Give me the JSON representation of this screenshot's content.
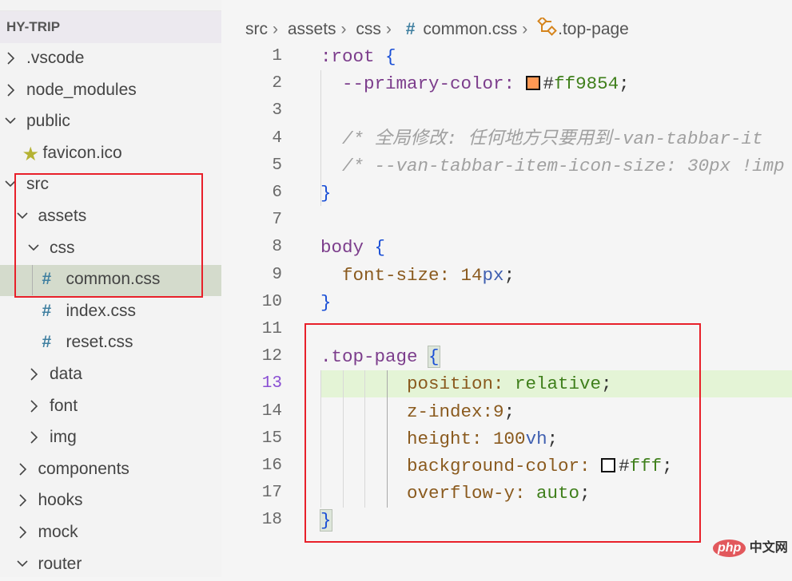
{
  "explorer": {
    "title": "HY-TRIP",
    "items": [
      {
        "label": ".vscode",
        "level": 0,
        "type": "folder",
        "expanded": false
      },
      {
        "label": "node_modules",
        "level": 0,
        "type": "folder",
        "expanded": false
      },
      {
        "label": "public",
        "level": 0,
        "type": "folder",
        "expanded": true
      },
      {
        "label": "favicon.ico",
        "level": 1,
        "type": "star-file"
      },
      {
        "label": "src",
        "level": 0,
        "type": "folder",
        "expanded": true
      },
      {
        "label": "assets",
        "level": 1,
        "type": "folder",
        "expanded": true
      },
      {
        "label": "css",
        "level": 2,
        "type": "folder",
        "expanded": true
      },
      {
        "label": "common.css",
        "level": 3,
        "type": "css-file",
        "selected": true
      },
      {
        "label": "index.css",
        "level": 3,
        "type": "css-file"
      },
      {
        "label": "reset.css",
        "level": 3,
        "type": "css-file"
      },
      {
        "label": "data",
        "level": 2,
        "type": "folder",
        "expanded": false
      },
      {
        "label": "font",
        "level": 2,
        "type": "folder",
        "expanded": false
      },
      {
        "label": "img",
        "level": 2,
        "type": "folder",
        "expanded": false
      },
      {
        "label": "components",
        "level": 1,
        "type": "folder",
        "expanded": false
      },
      {
        "label": "hooks",
        "level": 1,
        "type": "folder",
        "expanded": false
      },
      {
        "label": "mock",
        "level": 1,
        "type": "folder",
        "expanded": false
      },
      {
        "label": "router",
        "level": 1,
        "type": "folder",
        "expanded": true
      }
    ]
  },
  "breadcrumb": [
    "src",
    "assets",
    "css",
    "common.css",
    ".top-page"
  ],
  "editor": {
    "current_line": 13,
    "lines": [
      {
        "n": "1",
        "tokens": [
          [
            ":root ",
            "sel-prop"
          ],
          [
            "{",
            "brace"
          ]
        ]
      },
      {
        "n": "2",
        "tokens": [
          [
            "  --primary-color: ",
            "sel-prop"
          ],
          [
            "#swatch:#ff9854",
            ""
          ],
          [
            "#",
            "punc"
          ],
          [
            "ff9854",
            "hex"
          ],
          [
            ";",
            "punc"
          ]
        ]
      },
      {
        "n": "3",
        "tokens": []
      },
      {
        "n": "4",
        "tokens": [
          [
            "  /* 全局修改: 任何地方只要用到-van-tabbar-it",
            "cmt"
          ]
        ]
      },
      {
        "n": "5",
        "tokens": [
          [
            "  /* --van-tabbar-item-icon-size: 30px !imp",
            "cmt"
          ]
        ]
      },
      {
        "n": "6",
        "tokens": [
          [
            "}",
            "brace"
          ]
        ]
      },
      {
        "n": "7",
        "tokens": []
      },
      {
        "n": "8",
        "tokens": [
          [
            "body ",
            "sel-prop"
          ],
          [
            "{",
            "brace"
          ]
        ]
      },
      {
        "n": "9",
        "tokens": [
          [
            "  font-size: ",
            "prop"
          ],
          [
            "14",
            "num"
          ],
          [
            "px",
            "unit"
          ],
          [
            ";",
            "punc"
          ]
        ]
      },
      {
        "n": "10",
        "tokens": [
          [
            "}",
            "brace"
          ]
        ]
      },
      {
        "n": "11",
        "tokens": []
      },
      {
        "n": "12",
        "tokens": [
          [
            ".top-page ",
            "sel-prop"
          ],
          [
            "{",
            "brace bm"
          ]
        ]
      },
      {
        "n": "13",
        "tokens": [
          [
            "        position: ",
            "prop"
          ],
          [
            "relative",
            "val"
          ],
          [
            ";",
            "punc"
          ]
        ]
      },
      {
        "n": "14",
        "tokens": [
          [
            "        z-index:",
            "prop"
          ],
          [
            "9",
            "num"
          ],
          [
            ";",
            "punc"
          ]
        ]
      },
      {
        "n": "15",
        "tokens": [
          [
            "        height: ",
            "prop"
          ],
          [
            "100",
            "num"
          ],
          [
            "vh",
            "unit"
          ],
          [
            ";",
            "punc"
          ]
        ]
      },
      {
        "n": "16",
        "tokens": [
          [
            "        background-color: ",
            "prop"
          ],
          [
            "#swatch:#ffffff",
            ""
          ],
          [
            "#",
            "punc"
          ],
          [
            "fff",
            "hex"
          ],
          [
            ";",
            "punc"
          ]
        ]
      },
      {
        "n": "17",
        "tokens": [
          [
            "        overflow-y: ",
            "prop"
          ],
          [
            "auto",
            "val"
          ],
          [
            ";",
            "punc"
          ]
        ]
      },
      {
        "n": "18",
        "tokens": [
          [
            "}",
            "brace bm"
          ]
        ]
      }
    ]
  },
  "colors": {
    "highlight": "#red-box",
    "annotation": "#e8202a",
    "primary_swatch": "#ff9854"
  },
  "watermark": {
    "php": "php",
    "cn": "中文网"
  }
}
